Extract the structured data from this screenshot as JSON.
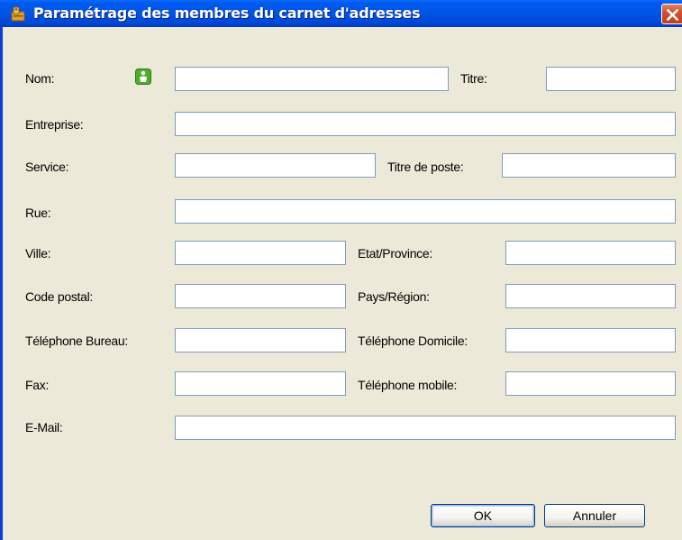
{
  "window": {
    "title": "Paramétrage des membres du carnet d'adresses"
  },
  "icons": {
    "title": "address-book-icon",
    "close": "close-icon",
    "contact": "person-icon"
  },
  "colors": {
    "titlebar": "#0055e5",
    "close": "#d3512d",
    "contact_icon": "#4caf2a",
    "field_border": "#7f9db9"
  },
  "form": {
    "nom": {
      "label": "Nom:",
      "value": ""
    },
    "titre": {
      "label": "Titre:",
      "value": ""
    },
    "entreprise": {
      "label": "Entreprise:",
      "value": ""
    },
    "service": {
      "label": "Service:",
      "value": ""
    },
    "titre_poste": {
      "label": "Titre de poste:",
      "value": ""
    },
    "rue": {
      "label": "Rue:",
      "value": ""
    },
    "ville": {
      "label": "Ville:",
      "value": ""
    },
    "etat": {
      "label": "Etat/Province:",
      "value": ""
    },
    "code_postal": {
      "label": "Code postal:",
      "value": ""
    },
    "pays": {
      "label": "Pays/Région:",
      "value": ""
    },
    "tel_bureau": {
      "label": "Téléphone Bureau:",
      "value": ""
    },
    "tel_domicile": {
      "label": "Téléphone Domicile:",
      "value": ""
    },
    "fax": {
      "label": "Fax:",
      "value": ""
    },
    "tel_mobile": {
      "label": "Téléphone mobile:",
      "value": ""
    },
    "email": {
      "label": "E-Mail:",
      "value": ""
    }
  },
  "buttons": {
    "ok": "OK",
    "cancel": "Annuler"
  }
}
